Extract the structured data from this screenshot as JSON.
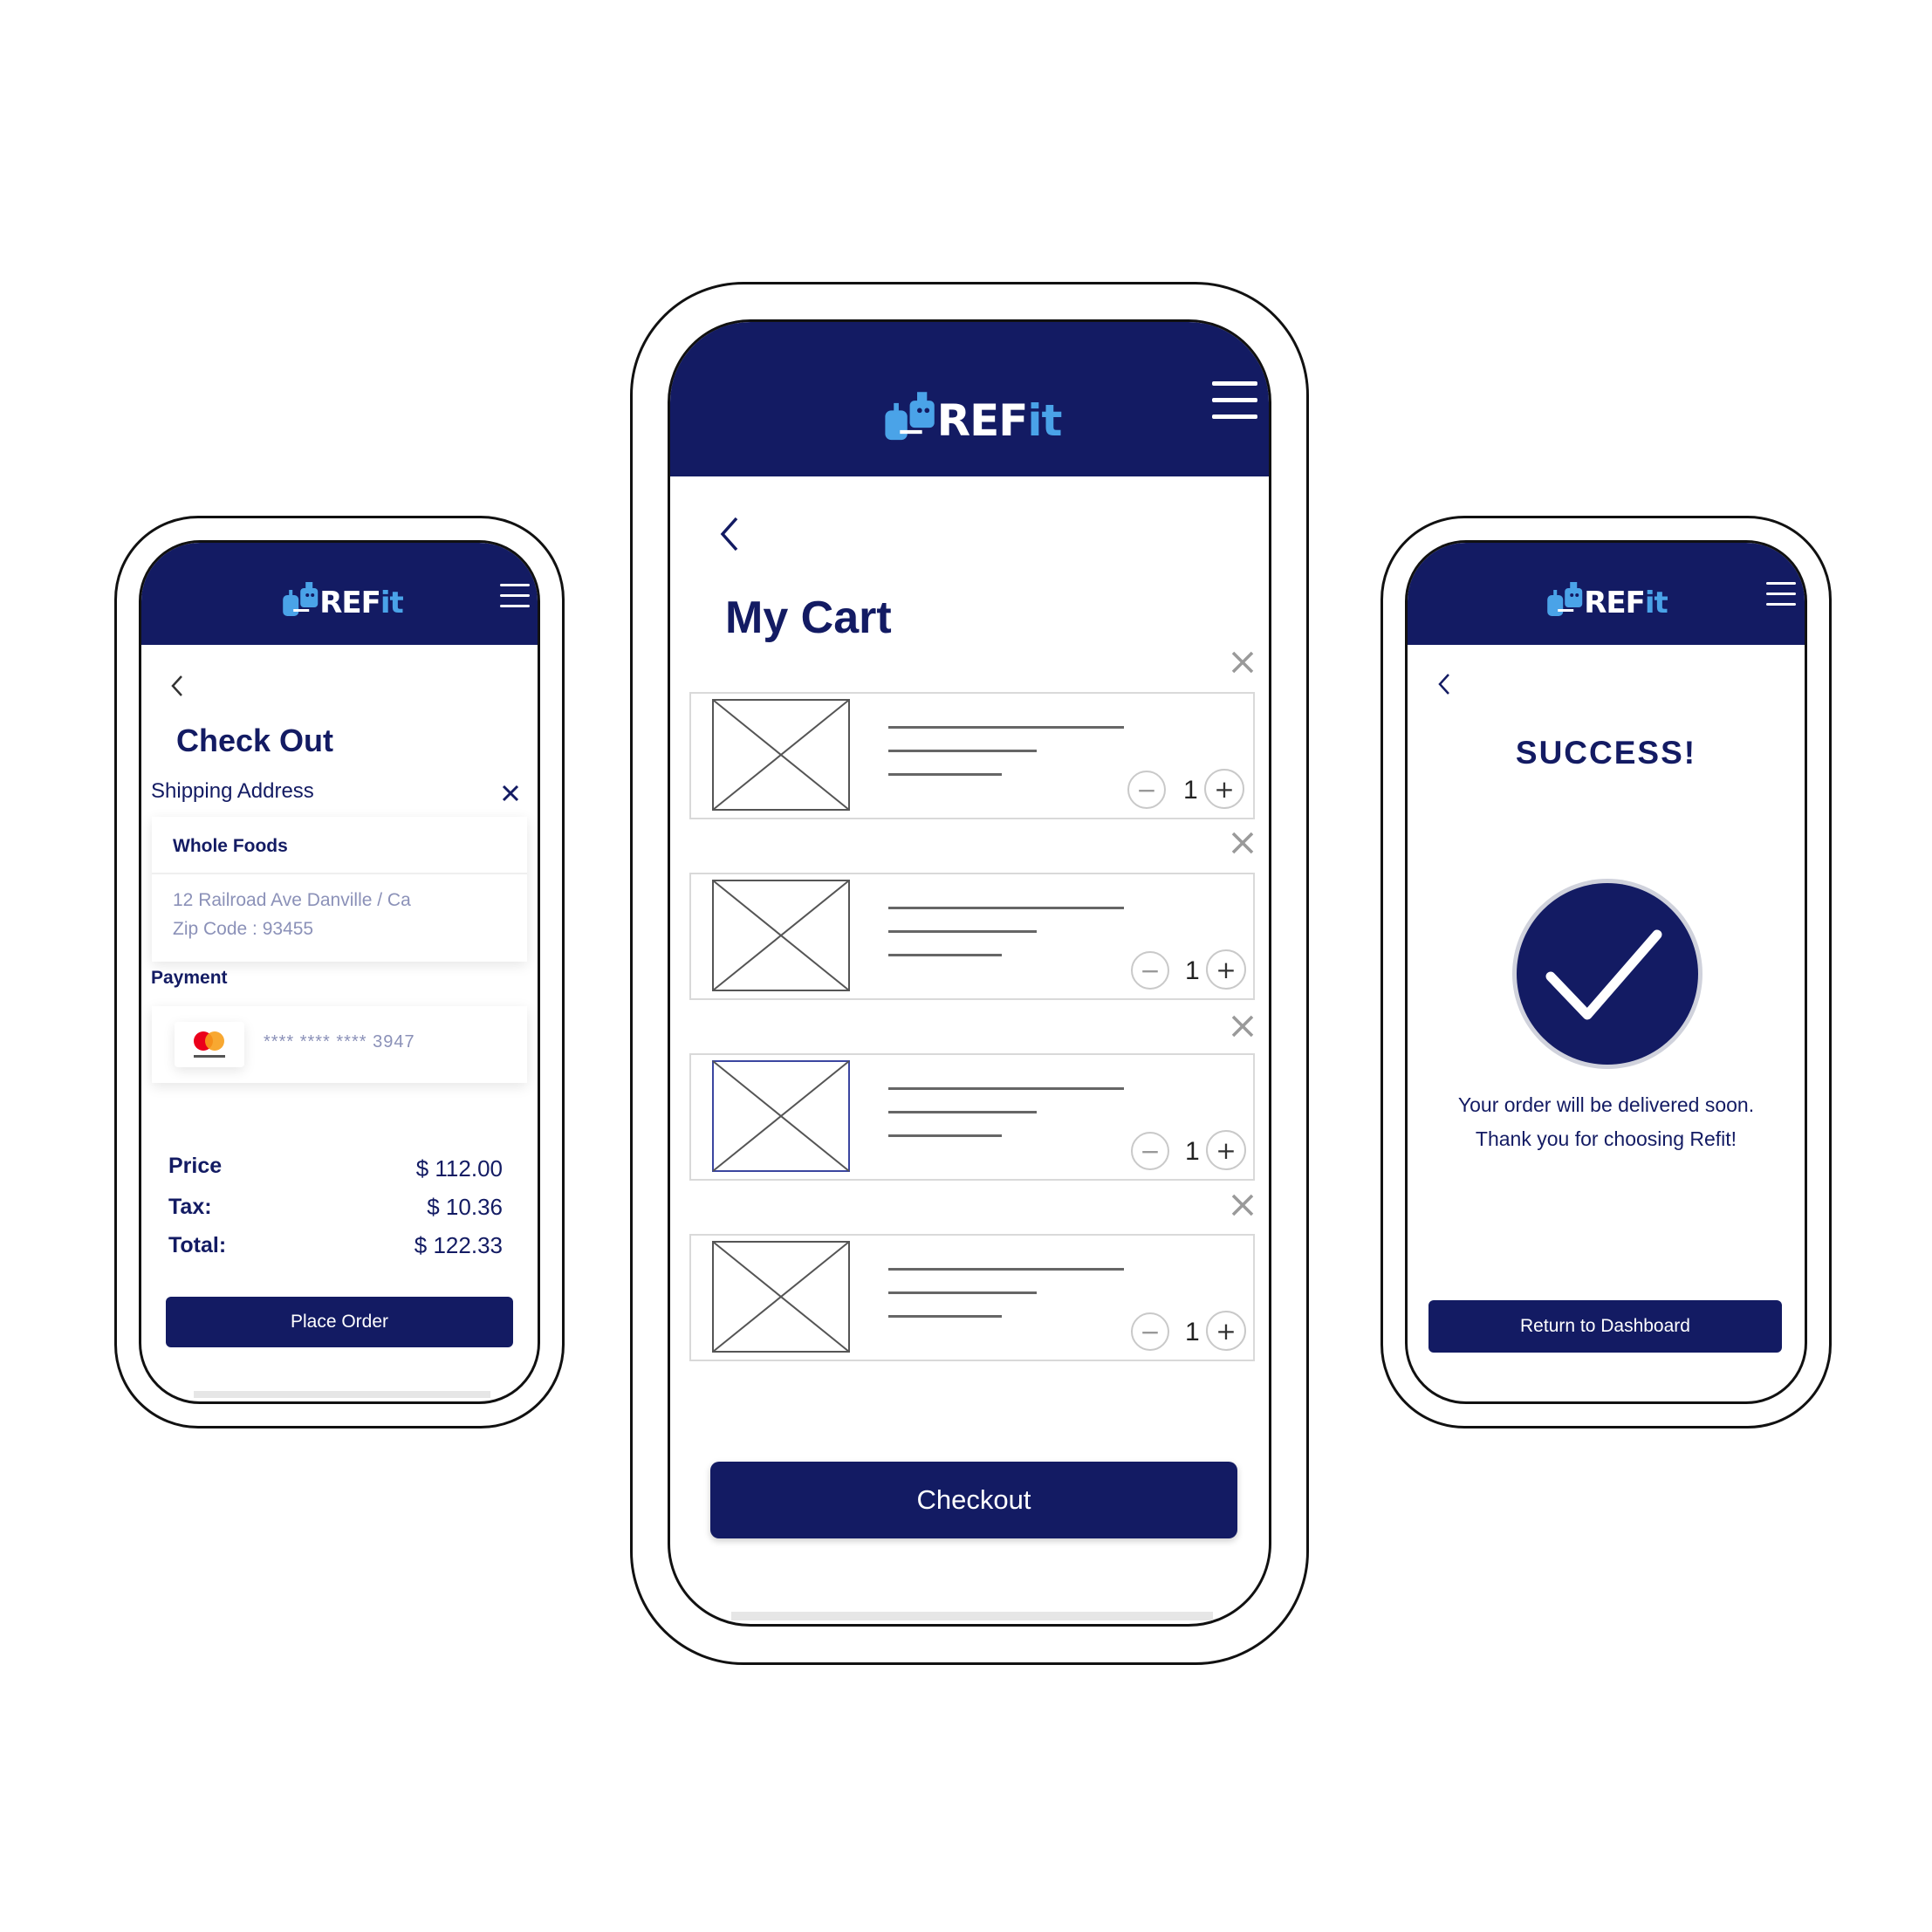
{
  "brand": {
    "logo_text_main": "REF",
    "logo_text_accent": "it",
    "primary_color": "#131B63",
    "accent_color": "#4AA3E8"
  },
  "checkout": {
    "title": "Check Out",
    "shipping_label": "Shipping Address",
    "store_name": "Whole Foods",
    "address_line1": "12 Railroad Ave Danville / Ca",
    "address_line2": "Zip Code : 93455",
    "payment_label": "Payment",
    "card_brand": "mastercard",
    "card_number": "**** **** **** 3947",
    "price_label": "Price",
    "price_value": "$ 112.00",
    "tax_label": "Tax:",
    "tax_value": "$ 10.36",
    "total_label": "Total:",
    "total_value": "$ 122.33",
    "place_order_label": "Place Order"
  },
  "cart": {
    "title": "My Cart",
    "items": [
      {
        "quantity": "1"
      },
      {
        "quantity": "1"
      },
      {
        "quantity": "1"
      },
      {
        "quantity": "1"
      }
    ],
    "checkout_label": "Checkout"
  },
  "success": {
    "title": "SUCCESS!",
    "message_line1": "Your order will be delivered soon.",
    "message_line2": "Thank you for choosing Refit!",
    "return_label": "Return to Dashboard"
  }
}
